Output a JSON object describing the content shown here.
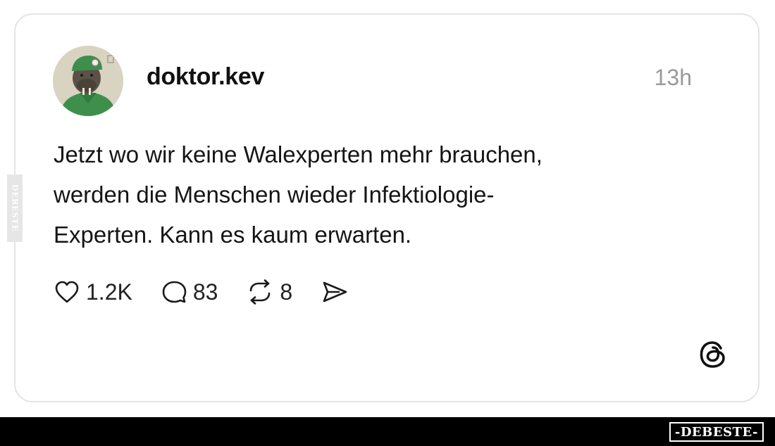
{
  "post": {
    "username": "doktor.kev",
    "timestamp": "13h",
    "text": "Jetzt wo wir keine Walexperten mehr brauchen,\nwerden die Menschen wieder Infektiologie-\nExperten. Kann es kaum erwarten.",
    "avatar_icon": "walrus-doctor-avatar"
  },
  "actions": {
    "like": {
      "icon": "heart-icon",
      "count": "1.2K"
    },
    "comment": {
      "icon": "comment-icon",
      "count": "83"
    },
    "repost": {
      "icon": "repost-icon",
      "count": "8"
    },
    "share": {
      "icon": "send-icon"
    }
  },
  "branding": {
    "platform_icon": "threads-logo-icon",
    "side_watermark": "DEBESTE",
    "bottom_watermark": "-DEBESTE-"
  },
  "colors": {
    "card_border": "#e4e4e4",
    "timestamp": "#9a9a9a",
    "text": "#151515",
    "bottom_bar": "#000000"
  }
}
